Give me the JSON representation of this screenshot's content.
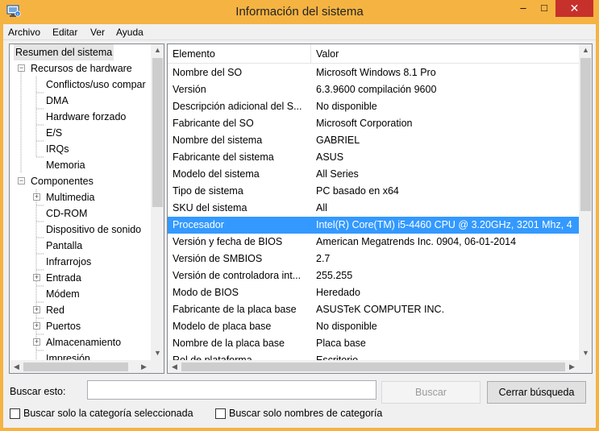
{
  "window": {
    "title": "Información del sistema",
    "minimize": "–",
    "maximize": "□",
    "close": "✕"
  },
  "menu": [
    "Archivo",
    "Editar",
    "Ver",
    "Ayuda"
  ],
  "tree": {
    "items": [
      {
        "label": "Resumen del sistema",
        "level": 0,
        "expander": "",
        "selected": true
      },
      {
        "label": "Recursos de hardware",
        "level": 1,
        "expander": "−"
      },
      {
        "label": "Conflictos/uso compar",
        "level": 2,
        "expander": ""
      },
      {
        "label": "DMA",
        "level": 2,
        "expander": ""
      },
      {
        "label": "Hardware forzado",
        "level": 2,
        "expander": ""
      },
      {
        "label": "E/S",
        "level": 2,
        "expander": ""
      },
      {
        "label": "IRQs",
        "level": 2,
        "expander": ""
      },
      {
        "label": "Memoria",
        "level": 2,
        "expander": ""
      },
      {
        "label": "Componentes",
        "level": 1,
        "expander": "−"
      },
      {
        "label": "Multimedia",
        "level": 2,
        "expander": "+"
      },
      {
        "label": "CD-ROM",
        "level": 2,
        "expander": ""
      },
      {
        "label": "Dispositivo de sonido",
        "level": 2,
        "expander": ""
      },
      {
        "label": "Pantalla",
        "level": 2,
        "expander": ""
      },
      {
        "label": "Infrarrojos",
        "level": 2,
        "expander": ""
      },
      {
        "label": "Entrada",
        "level": 2,
        "expander": "+"
      },
      {
        "label": "Módem",
        "level": 2,
        "expander": ""
      },
      {
        "label": "Red",
        "level": 2,
        "expander": "+"
      },
      {
        "label": "Puertos",
        "level": 2,
        "expander": "+"
      },
      {
        "label": "Almacenamiento",
        "level": 2,
        "expander": "+"
      },
      {
        "label": "Impresión",
        "level": 2,
        "expander": ""
      }
    ]
  },
  "list": {
    "columns": [
      "Elemento",
      "Valor"
    ],
    "rows": [
      {
        "elemento": "Nombre del SO",
        "valor": "Microsoft Windows 8.1 Pro"
      },
      {
        "elemento": "Versión",
        "valor": "6.3.9600 compilación 9600"
      },
      {
        "elemento": "Descripción adicional del S...",
        "valor": "No disponible"
      },
      {
        "elemento": "Fabricante del SO",
        "valor": "Microsoft Corporation"
      },
      {
        "elemento": "Nombre del sistema",
        "valor": "GABRIEL"
      },
      {
        "elemento": "Fabricante del sistema",
        "valor": "ASUS"
      },
      {
        "elemento": "Modelo del sistema",
        "valor": "All Series"
      },
      {
        "elemento": "Tipo de sistema",
        "valor": "PC basado en x64"
      },
      {
        "elemento": "SKU del sistema",
        "valor": "All"
      },
      {
        "elemento": "Procesador",
        "valor": "Intel(R) Core(TM) i5-4460  CPU @ 3.20GHz, 3201 Mhz, 4",
        "selected": true
      },
      {
        "elemento": "Versión y fecha de BIOS",
        "valor": "American Megatrends Inc. 0904, 06-01-2014"
      },
      {
        "elemento": "Versión de SMBIOS",
        "valor": "2.7"
      },
      {
        "elemento": "Versión de controladora int...",
        "valor": "255.255"
      },
      {
        "elemento": "Modo de BIOS",
        "valor": "Heredado"
      },
      {
        "elemento": "Fabricante de la placa base",
        "valor": "ASUSTeK COMPUTER INC."
      },
      {
        "elemento": "Modelo de placa base",
        "valor": "No disponible"
      },
      {
        "elemento": "Nombre de la placa base",
        "valor": "Placa base"
      },
      {
        "elemento": "Rol de plataforma",
        "valor": "Escritorio"
      }
    ]
  },
  "search": {
    "label": "Buscar esto:",
    "value": "",
    "search_button": "Buscar",
    "clear_button": "Cerrar búsqueda",
    "option_selected_category": "Buscar solo la categoría seleccionada",
    "option_category_names": "Buscar solo nombres de categoría"
  },
  "colors": {
    "titlebar": "#f5b342",
    "close": "#c7312b",
    "selection": "#3399ff"
  }
}
